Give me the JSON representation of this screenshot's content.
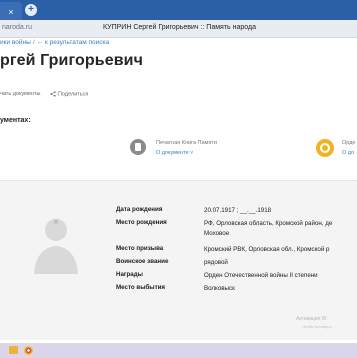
{
  "browser": {
    "tab_close_glyph": "×",
    "new_tab_glyph": "+",
    "url": "naroda.ru",
    "tab_title": "КУПРИН Сергей Григорьевич :: Память народа"
  },
  "breadcrumb": {
    "crumb1": "ики войны",
    "separator": "/",
    "crumb2": "← к результатам поиска"
  },
  "page_title": "ргей Григорьевич",
  "actions": {
    "print": "чать документы",
    "share": "Поделиться"
  },
  "documents_label": "ументах:",
  "documents": [
    {
      "title": "Печатная Книга Памяти",
      "link": "О документе ˅"
    },
    {
      "title": "Орде",
      "link": "О до"
    }
  ],
  "person": {
    "rows": [
      {
        "label": "Дата рождения",
        "value": "20.07.1917 ; __.__.1918"
      },
      {
        "label": "Место рождения",
        "value": "РФ, Орловская область, Кромской район, де",
        "value2": "Моховое"
      },
      {
        "label": "Место призыва",
        "value": "Кромский РВК, Орловская обл., Кромской р"
      },
      {
        "label": "Воинское звание",
        "value": "рядовой"
      },
      {
        "label": "Награды",
        "value": "Орден Отечественной войны II степени"
      },
      {
        "label": "Место выбытия",
        "value": "Волковыск"
      }
    ]
  },
  "watermark": {
    "line1": "Активация W",
    "line2": "Чтобы активиро"
  },
  "colors": {
    "browser_blue": "#2b5fa6",
    "link_blue": "#3b7fc2",
    "band_gray": "#f4f4f4",
    "award_gold": "#f0b323"
  },
  "icons": [
    "close-icon",
    "plus-icon",
    "share-icon",
    "document-icon",
    "order-medal-icon",
    "person-silhouette-icon",
    "folder-icon",
    "chrome-icon"
  ]
}
